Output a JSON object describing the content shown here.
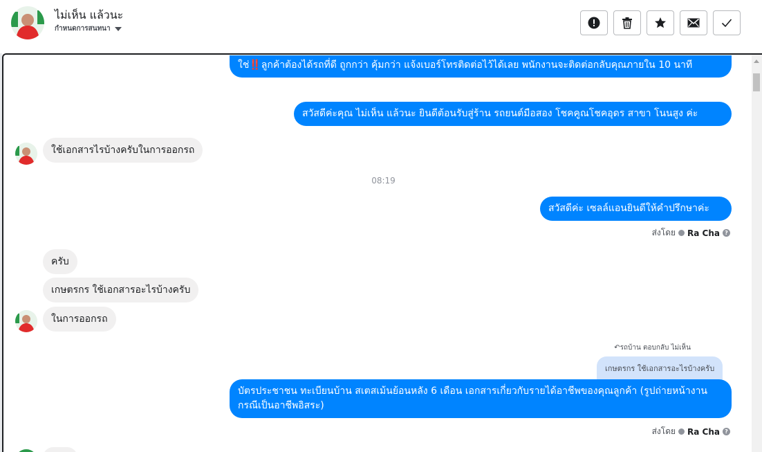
{
  "header": {
    "name": "ไม่เห็น แล้วนะ",
    "status": "กำหนดการสนทนา",
    "actions": [
      {
        "name": "report",
        "icon": "alert-icon"
      },
      {
        "name": "delete",
        "icon": "trash-icon"
      },
      {
        "name": "star",
        "icon": "star-icon"
      },
      {
        "name": "mark-unread",
        "icon": "envelope-icon"
      },
      {
        "name": "done",
        "icon": "check-icon"
      }
    ]
  },
  "messages": {
    "m1_text": "ใช่‼️ลูกค้าต้องได้รถที่ดี ถูกกว่า คุ้มกว่า แจ้งเบอร์โทรติดต่อไว้ได้เลย พนักงานจะติดต่อกลับคุณภายใน 10 นาที",
    "m2_text": "สวัสดีค่ะคุณ ไม่เห็น แล้วนะ ยินดีต้อนรับสู่ร้าน รถยนต์มือสอง โชคคูณโชคอุดร สาขา โนนสูง ค่ะ",
    "m3_text": "ใช้เอกสารไรบ้างครับในการออกรถ",
    "time": "08:19",
    "m4_text": "สวัสดีค่ะ เซลล์แอนยินดีให้คำปรึกษาค่ะ",
    "sent_by_label": "ส่งโดย",
    "sent_by_name": "Ra Cha",
    "m5_text": "ครับ",
    "m6_text": "เกษตรกร ใช้เอกสารอะไรบ้างครับ",
    "m7_text": "ในการออกรถ",
    "reply_note": "รถบ้าน ตอบกลับ ไม่เห็น",
    "reply_quote": "เกษตรกร ใช้เอกสารอะไรบ้างครับ",
    "m8_text": "บัตรประชาชน ทะเบียนบ้าน สเตสเม้นย้อนหลัง 6 เดือน เอกสารเกี่ยวกับรายได้อาชีพของคุณลูกค้า (รูปถ่ายหน้างาน กรณีเป็นอาชีพอิสระ)"
  },
  "colors": {
    "outgoing": "#0084ff",
    "incoming": "#f1f0f0",
    "reply": "#d2e3fb"
  }
}
